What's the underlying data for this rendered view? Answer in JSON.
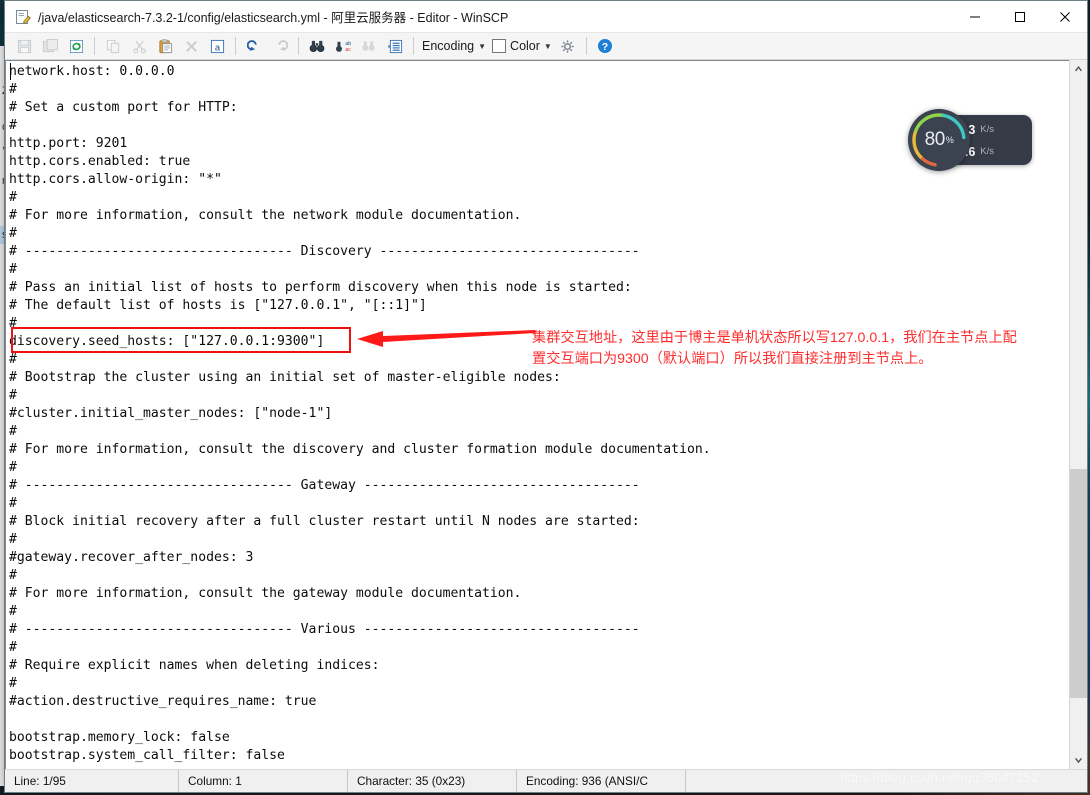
{
  "window": {
    "title": "/java/elasticsearch-7.3.2-1/config/elasticsearch.yml - 阿里云服务器 - Editor - WinSCP",
    "app_icon": "edit-document-icon",
    "minimize_label": "—",
    "maximize_label": "☐",
    "close_label": "✕"
  },
  "toolbar": {
    "buttons": [
      {
        "name": "save-button",
        "glyph": "💾",
        "enabled": false
      },
      {
        "name": "save-as-button",
        "glyph": "🗂",
        "enabled": false
      },
      {
        "name": "reload-button",
        "glyph": "↻",
        "enabled": true
      },
      {
        "name": "copy-button",
        "glyph": "❐",
        "enabled": false
      },
      {
        "name": "cut-button",
        "glyph": "✂",
        "enabled": false
      },
      {
        "name": "paste-button",
        "glyph": "📋",
        "enabled": true
      },
      {
        "name": "delete-button",
        "glyph": "✕",
        "enabled": false
      },
      {
        "name": "select-all-button",
        "glyph": "a",
        "enabled": true
      },
      {
        "name": "undo-button",
        "glyph": "↶",
        "enabled": true
      },
      {
        "name": "redo-button",
        "glyph": "↷",
        "enabled": false
      },
      {
        "name": "find-button",
        "glyph": "🔍",
        "enabled": true
      },
      {
        "name": "replace-button",
        "glyph": "ab",
        "enabled": true
      },
      {
        "name": "find-next-button",
        "glyph": "🔎",
        "enabled": false
      },
      {
        "name": "go-to-line-button",
        "glyph": "≡",
        "enabled": true
      }
    ],
    "encoding_label": "Encoding",
    "color_label": "Color",
    "preferences_name": "gear-icon",
    "help_name": "help-icon",
    "caret_glyph": "▼"
  },
  "editor": {
    "lines": [
      "network.host: 0.0.0.0",
      "#",
      "# Set a custom port for HTTP:",
      "#",
      "http.port: 9201",
      "http.cors.enabled: true",
      "http.cors.allow-origin: \"*\"",
      "#",
      "# For more information, consult the network module documentation.",
      "#",
      "# ---------------------------------- Discovery ---------------------------------",
      "#",
      "# Pass an initial list of hosts to perform discovery when this node is started:",
      "# The default list of hosts is [\"127.0.0.1\", \"[::1]\"]",
      "#",
      "discovery.seed_hosts: [\"127.0.0.1:9300\"]",
      "#",
      "# Bootstrap the cluster using an initial set of master-eligible nodes:",
      "#",
      "#cluster.initial_master_nodes: [\"node-1\"]",
      "#",
      "# For more information, consult the discovery and cluster formation module documentation.",
      "#",
      "# ---------------------------------- Gateway -----------------------------------",
      "#",
      "# Block initial recovery after a full cluster restart until N nodes are started:",
      "#",
      "#gateway.recover_after_nodes: 3",
      "#",
      "# For more information, consult the gateway module documentation.",
      "#",
      "# ---------------------------------- Various -----------------------------------",
      "#",
      "# Require explicit names when deleting indices:",
      "#",
      "#action.destructive_requires_name: true",
      "",
      "bootstrap.memory_lock: false",
      "bootstrap.system_call_filter: false"
    ]
  },
  "scrollbar": {
    "up_arrow": "▲",
    "down_arrow": "▼"
  },
  "statusbar": {
    "line": "Line: 1/95",
    "column": "Column: 1",
    "character": "Character: 35 (0x23)",
    "encoding": "Encoding: 936   (ANSI/C"
  },
  "annotation": {
    "line1": "集群交互地址，这里由于博主是单机状态所以写127.0.0.1，我们在主节点上配",
    "line2": "置交互端口为9300（默认端口）所以我们直接注册到主节点上。",
    "color": "#ff2d2d",
    "highlight_target": "discovery.seed_hosts: [\"127.0.0.1:9300\"]",
    "arrow_name": "red-left-arrow"
  },
  "network_monitor": {
    "cpu_percent": "80",
    "percent_symbol": "%",
    "upload_value": "1.3",
    "upload_unit": "K/s",
    "download_value": "1.6",
    "download_unit": "K/s",
    "up_arrow": "↑",
    "down_arrow": "↓"
  },
  "background_window": {
    "rows": [
      "",
      "Z",
      "",
      "ch",
      ",",
      "",
      "nt",
      "",
      "",
      "st",
      "",
      "",
      "",
      ""
    ],
    "selected_index": 9
  },
  "watermark": {
    "text": "https://blog.csdn.net/qq36047252"
  }
}
